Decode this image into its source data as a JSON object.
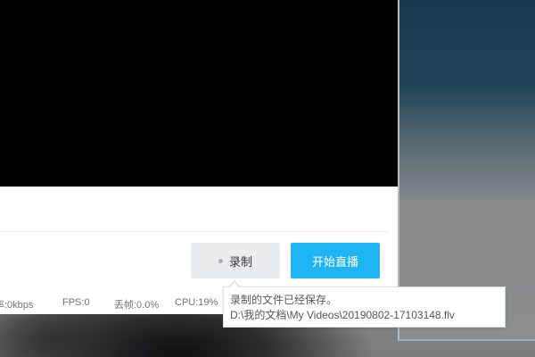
{
  "controls": {
    "record_label": "录制",
    "start_live_label": "开始直播"
  },
  "status": {
    "bitrate": "率:0kbps",
    "fps": "FPS:0",
    "dropped_frames": "丢帧:0.0%",
    "cpu": "CPU:19%"
  },
  "tooltip": {
    "message": "录制的文件已经保存。",
    "path": "D:\\我的文档\\My Videos\\20190802-17103148.flv"
  },
  "colors": {
    "start_live_button": "#1fb4f4",
    "record_button": "#e9ecf0",
    "preview_background": "#000000"
  },
  "icons": {
    "record_indicator": "record-dot-icon"
  }
}
